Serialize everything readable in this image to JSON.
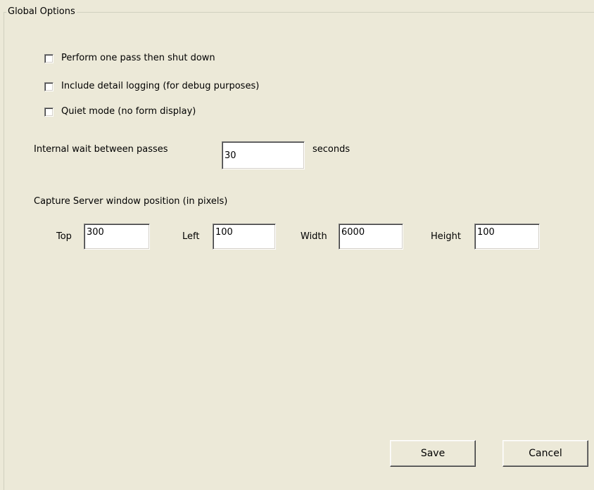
{
  "group": {
    "title": "Global Options"
  },
  "options": [
    {
      "label": "Perform one pass then shut down",
      "checked": false
    },
    {
      "label": "Include detail logging (for debug purposes)",
      "checked": false
    },
    {
      "label": "Quiet mode (no form display)",
      "checked": false
    }
  ],
  "wait": {
    "label": "Internal wait between passes",
    "value": "30",
    "unit": "seconds"
  },
  "position": {
    "heading": "Capture Server window position (in pixels)",
    "top_label": "Top",
    "top_value": "300",
    "left_label": "Left",
    "left_value": "100",
    "width_label": "Width",
    "width_value": "6000",
    "height_label": "Height",
    "height_value": "100"
  },
  "buttons": {
    "save": "Save",
    "cancel": "Cancel"
  }
}
